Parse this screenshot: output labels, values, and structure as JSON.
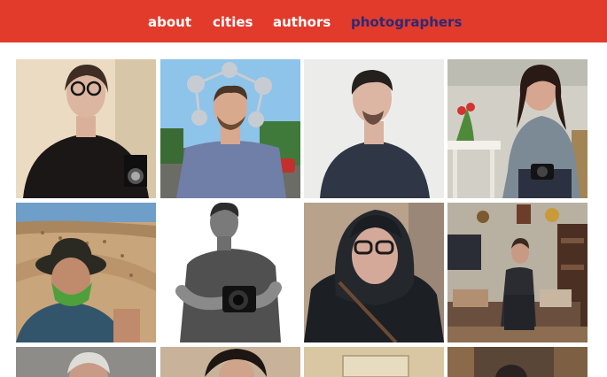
{
  "nav": {
    "items": [
      {
        "label": "about",
        "active": false
      },
      {
        "label": "cities",
        "active": false
      },
      {
        "label": "authors",
        "active": false
      },
      {
        "label": "photographers",
        "active": true
      }
    ],
    "background": "#e23b2c",
    "text_color": "#ffffff",
    "active_color": "#2d2a72"
  },
  "photos": [
    {
      "name": "photo-woman-glasses-camera"
    },
    {
      "name": "photo-man-atomium"
    },
    {
      "name": "photo-man-dark-shirt"
    },
    {
      "name": "photo-woman-kitchen-camera"
    },
    {
      "name": "photo-man-desert-dunes"
    },
    {
      "name": "photo-man-bw-camera"
    },
    {
      "name": "photo-man-hood-glasses"
    },
    {
      "name": "photo-man-living-room"
    },
    {
      "name": "photo-bottom-1"
    },
    {
      "name": "photo-bottom-2"
    },
    {
      "name": "photo-bottom-3"
    },
    {
      "name": "photo-bottom-4"
    }
  ]
}
